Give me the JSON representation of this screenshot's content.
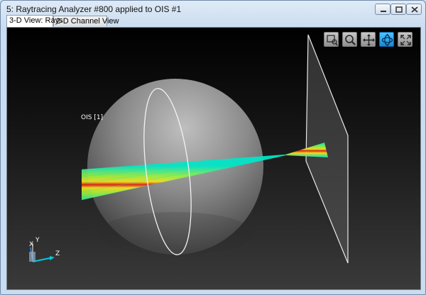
{
  "window": {
    "title": "5: Raytracing Analyzer #800 applied to OIS #1"
  },
  "tabs": [
    {
      "label": "3-D View: Rays",
      "active": true
    },
    {
      "label": "2-D Channel View",
      "active": false
    }
  ],
  "toolbar": {
    "tools": [
      {
        "icon": "zoom-box-icon",
        "active": false
      },
      {
        "icon": "magnifier-icon",
        "active": false
      },
      {
        "icon": "pan-arrows-icon",
        "active": false
      },
      {
        "icon": "rotate-orbit-icon",
        "active": true
      },
      {
        "icon": "fit-expand-icon",
        "active": false
      }
    ]
  },
  "scene": {
    "object_label": "OIS [1]",
    "axes": {
      "x": "X",
      "y": "Y",
      "z": "Z"
    }
  },
  "colors": {
    "background_top": "#000000",
    "background_bottom": "#3a3a3a",
    "active_tool": "#1e9be6",
    "ray_edge": "#00e6c8",
    "ray_core": "#e0201a"
  }
}
